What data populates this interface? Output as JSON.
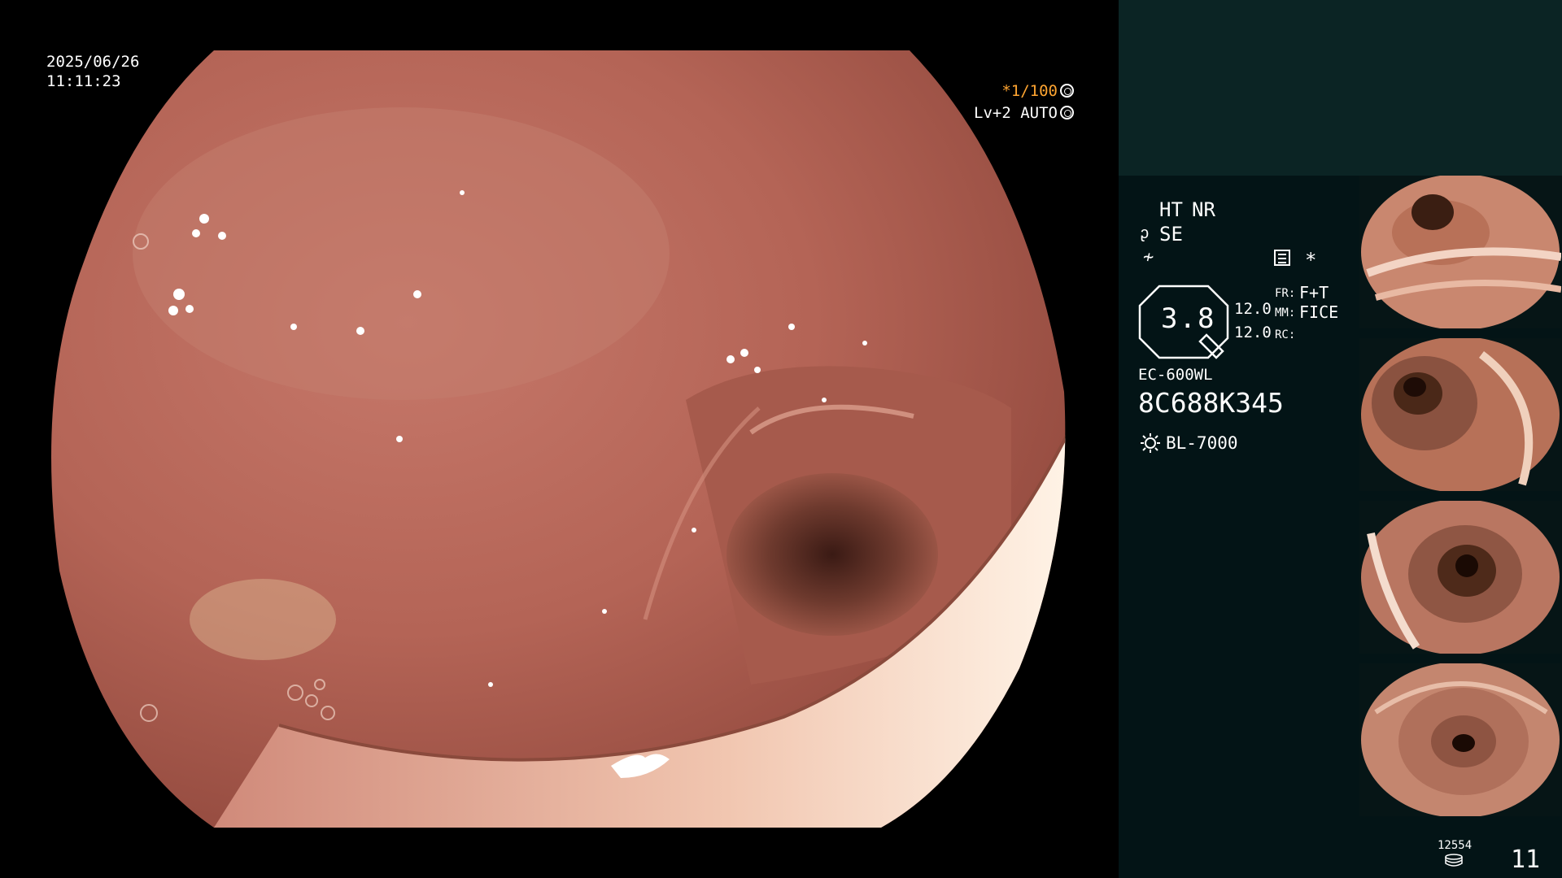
{
  "osd": {
    "date": "2025/06/26",
    "time": "11:11:23",
    "shutter": "*1/100",
    "level": "Lv+2 AUTO"
  },
  "panel": {
    "ht": "HT",
    "nr": "NR",
    "se": "SE",
    "se_icon": "ᶗ",
    "f_icon": "≁",
    "asterisk": "*",
    "octagon_value": "3.8",
    "value_1": "12.0",
    "value_2": "12.0",
    "fr_label": "FR:",
    "fr_value": "F+T",
    "mm_label": "MM:",
    "mm_value": "FICE",
    "rc_label": "RC:",
    "scope_model": "EC-600WL",
    "serial": "8C688K345",
    "light_source": "BL-7000",
    "count_small": "12554",
    "count_big": "11"
  },
  "icons": {
    "shutter_icon": "aperture-icon",
    "level_icon": "iris-icon",
    "menu_icon": "memo-icon",
    "light_icon": "light-bulb-icon",
    "storage_icon": "disk-stack-icon",
    "se_icon_name": "scope-tip-icon",
    "f_icon_name": "filter-icon"
  },
  "colors": {
    "highlight": "#ffa531",
    "panel_bg": "#031416",
    "panel_top_bg": "#0b2424",
    "tissue": "#b9685a"
  }
}
